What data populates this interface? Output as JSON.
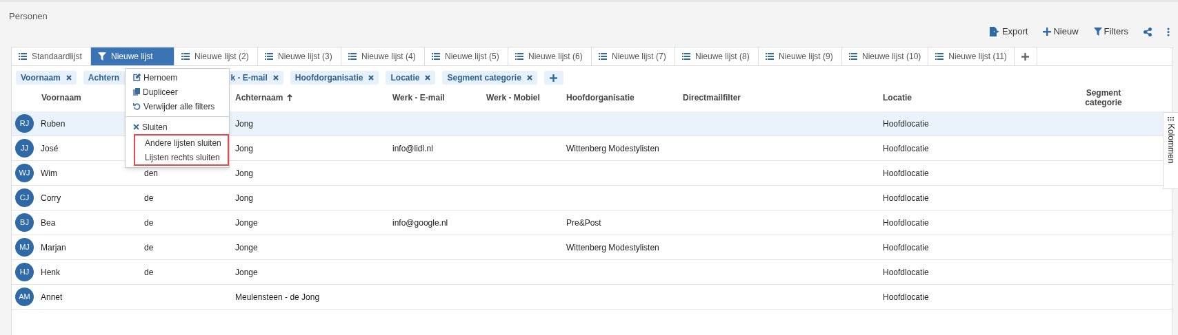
{
  "page": {
    "title": "Personen"
  },
  "toolbar": [
    {
      "kind": "export",
      "label": "Export"
    },
    {
      "kind": "new",
      "label": "Nieuw"
    },
    {
      "kind": "filter",
      "label": "Filters"
    },
    {
      "kind": "share"
    },
    {
      "kind": "more"
    }
  ],
  "tabs": [
    {
      "label": "Standaardlijst",
      "kind": "list",
      "selected": false
    },
    {
      "label": "Nieuwe lijst",
      "kind": "filtered",
      "selected": true
    },
    {
      "label": "Nieuwe lijst (2)",
      "kind": "list",
      "selected": false
    },
    {
      "label": "Nieuwe lijst (3)",
      "kind": "list",
      "selected": false
    },
    {
      "label": "Nieuwe lijst (4)",
      "kind": "list",
      "selected": false
    },
    {
      "label": "Nieuwe lijst (5)",
      "kind": "list",
      "selected": false
    },
    {
      "label": "Nieuwe lijst (6)",
      "kind": "list",
      "selected": false
    },
    {
      "label": "Nieuwe lijst (7)",
      "kind": "list",
      "selected": false
    },
    {
      "label": "Nieuwe lijst (8)",
      "kind": "list",
      "selected": false
    },
    {
      "label": "Nieuwe lijst (9)",
      "kind": "list",
      "selected": false
    },
    {
      "label": "Nieuwe lijst (10)",
      "kind": "list",
      "selected": false
    },
    {
      "label": "Nieuwe lijst (11)",
      "kind": "list",
      "selected": false
    }
  ],
  "filter_chips": [
    {
      "label": "Voornaam",
      "kind": "full"
    },
    {
      "label": "Achtern",
      "kind": "head"
    },
    {
      "label": "k - E-mail",
      "kind": "tail"
    },
    {
      "label": "Hoofdorganisatie",
      "kind": "full"
    },
    {
      "label": "Locatie",
      "kind": "full"
    },
    {
      "label": "Segment categorie",
      "kind": "full"
    }
  ],
  "table": {
    "columns": [
      {
        "label": "Voornaam"
      },
      {
        "label": "Achternaam",
        "sorted": true
      },
      {
        "label": "Werk - E-mail"
      },
      {
        "label": "Werk - Mobiel"
      },
      {
        "label": "Hoofdorganisatie"
      },
      {
        "label": "Directmailfilter"
      },
      {
        "label": "Locatie"
      },
      {
        "label": "Segment categorie"
      }
    ],
    "rows": [
      {
        "initials": "RJ",
        "voornaam": "Ruben",
        "achternaam": "Jong",
        "email": "",
        "organisatie": "",
        "locatie": "Hoofdlocatie",
        "selected": true
      },
      {
        "initials": "JJ",
        "voornaam": "José",
        "achternaam": "Jong",
        "email": "info@lidl.nl",
        "organisatie": "Wittenberg Modestylisten",
        "locatie": "Hoofdlocatie",
        "selected": false
      },
      {
        "initials": "WJ",
        "voornaam": "Wim",
        "tussenvoegsel": "den",
        "achternaam": "Jong",
        "email": "",
        "organisatie": "",
        "locatie": "Hoofdlocatie",
        "selected": false
      },
      {
        "initials": "CJ",
        "voornaam": "Corry",
        "tussenvoegsel": "de",
        "achternaam": "Jong",
        "email": "",
        "organisatie": "",
        "locatie": "Hoofdlocatie",
        "selected": false
      },
      {
        "initials": "BJ",
        "voornaam": "Bea",
        "tussenvoegsel": "de",
        "achternaam": "Jonge",
        "email": "info@google.nl",
        "organisatie": "Pre&Post",
        "locatie": "Hoofdlocatie",
        "selected": false
      },
      {
        "initials": "MJ",
        "voornaam": "Marjan",
        "tussenvoegsel": "de",
        "achternaam": "Jonge",
        "email": "",
        "organisatie": "Wittenberg Modestylisten",
        "locatie": "Hoofdlocatie",
        "selected": false
      },
      {
        "initials": "HJ",
        "voornaam": "Henk",
        "tussenvoegsel": "de",
        "achternaam": "Jonge",
        "email": "",
        "organisatie": "",
        "locatie": "Hoofdlocatie",
        "selected": false
      },
      {
        "initials": "AM",
        "voornaam": "Annet",
        "achternaam": "Meulensteen - de Jong",
        "email": "",
        "organisatie": "",
        "locatie": "Hoofdlocatie",
        "selected": false
      }
    ]
  },
  "columns_panel": {
    "label": "Kolommen"
  },
  "context_menu": {
    "items": [
      {
        "kind": "rename",
        "label": "Hernoem",
        "highlighted": false
      },
      {
        "kind": "duplicate",
        "label": "Dupliceer",
        "highlighted": false
      },
      {
        "kind": "reset",
        "label": "Verwijder alle filters",
        "highlighted": false
      },
      {
        "kind": "divider"
      },
      {
        "kind": "close",
        "label": "Sluiten",
        "highlighted": false
      },
      {
        "kind": "plain",
        "label": "Andere lijsten sluiten",
        "highlighted": true
      },
      {
        "kind": "plain",
        "label": "Lijsten rechts sluiten",
        "highlighted": true
      }
    ]
  }
}
